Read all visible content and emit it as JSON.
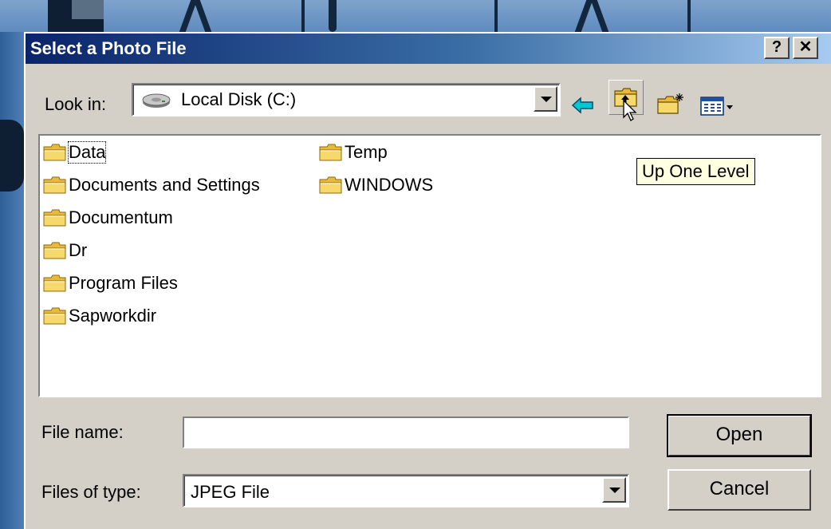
{
  "window": {
    "title": "Select a Photo File",
    "help_label": "?",
    "close_label": "✕"
  },
  "look_in": {
    "label": "Look in:",
    "value": "Local Disk (C:)",
    "drive_icon": "hard-drive-icon"
  },
  "toolbar": {
    "back_icon": "back-arrow-icon",
    "up_icon": "up-one-level-icon",
    "new_folder_icon": "new-folder-icon",
    "view_menu_icon": "view-menu-icon"
  },
  "tooltip": "Up One Level",
  "files": [
    {
      "name": "Data",
      "focused": true
    },
    {
      "name": "Documents and Settings"
    },
    {
      "name": "Documentum"
    },
    {
      "name": "Dr"
    },
    {
      "name": "Program Files"
    },
    {
      "name": "Sapworkdir"
    },
    {
      "name": "Temp"
    },
    {
      "name": "WINDOWS"
    }
  ],
  "file_name": {
    "label": "File name:",
    "value": ""
  },
  "file_type": {
    "label": "Files of type:",
    "value": "JPEG File"
  },
  "buttons": {
    "open": "Open",
    "cancel": "Cancel"
  },
  "colors": {
    "dialog_bg": "#d4d0c8",
    "title_start": "#0a246a",
    "title_end": "#a6caf0",
    "tooltip_bg": "#ffffe1",
    "folder_yellow": "#f2c84b"
  }
}
